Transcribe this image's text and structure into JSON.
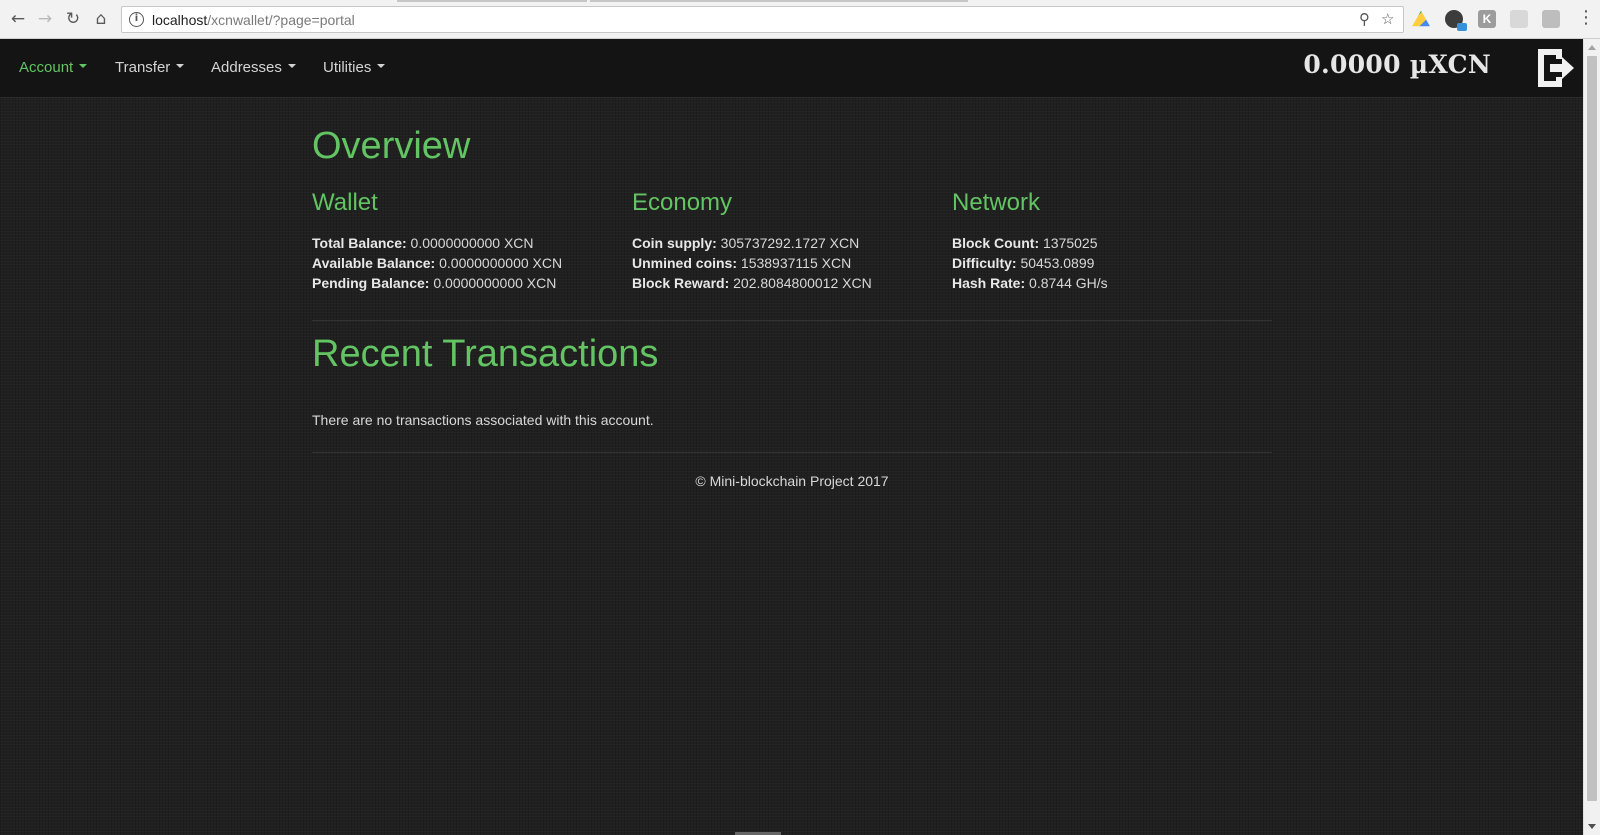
{
  "browser": {
    "url_host": "localhost",
    "url_path": "/xcnwallet/?page=portal",
    "back_icon": "arrow-left-icon",
    "forward_icon": "arrow-right-icon",
    "reload_icon": "reload-icon",
    "home_icon": "home-icon",
    "info_glyph": "i",
    "extensions": [
      "google-drive-icon",
      "chat-extension-icon",
      "k-extension-icon",
      "calendar-extension-icon",
      "bag-extension-icon"
    ]
  },
  "navbar": {
    "items": [
      {
        "label": "Account",
        "active": true
      },
      {
        "label": "Transfer",
        "active": false
      },
      {
        "label": "Addresses",
        "active": false
      },
      {
        "label": "Utilities",
        "active": false
      }
    ],
    "balance": "0.0000 µXCN"
  },
  "overview": {
    "title": "Overview",
    "wallet": {
      "heading": "Wallet",
      "rows": [
        {
          "label": "Total Balance:",
          "value": "0.0000000000 XCN"
        },
        {
          "label": "Available Balance:",
          "value": "0.0000000000 XCN"
        },
        {
          "label": "Pending Balance:",
          "value": "0.0000000000 XCN"
        }
      ]
    },
    "economy": {
      "heading": "Economy",
      "rows": [
        {
          "label": "Coin supply:",
          "value": "305737292.1727 XCN"
        },
        {
          "label": "Unmined coins:",
          "value": "1538937115 XCN"
        },
        {
          "label": "Block Reward:",
          "value": "202.8084800012 XCN"
        }
      ]
    },
    "network": {
      "heading": "Network",
      "rows": [
        {
          "label": "Block Count:",
          "value": "1375025"
        },
        {
          "label": "Difficulty:",
          "value": "50453.0899"
        },
        {
          "label": "Hash Rate:",
          "value": "0.8744 GH/s"
        }
      ]
    }
  },
  "recent": {
    "title": "Recent Transactions",
    "empty_message": "There are no transactions associated with this account."
  },
  "footer": {
    "text": "© Mini-blockchain Project 2017"
  },
  "colors": {
    "accent": "#62c462",
    "background": "#202020",
    "navbar": "#141414",
    "text": "#d8d8d8"
  }
}
